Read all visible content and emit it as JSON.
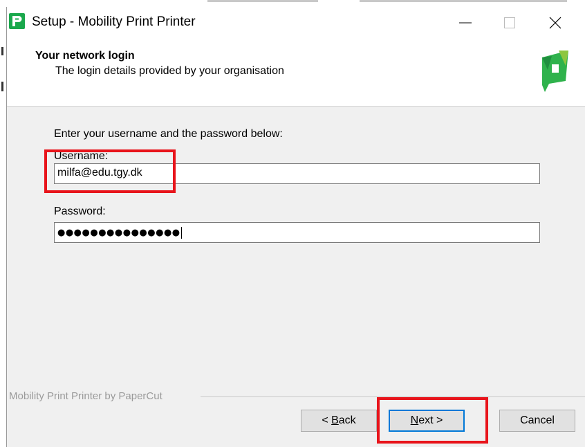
{
  "window": {
    "title": "Setup - Mobility Print Printer",
    "icon": "papercut-app-icon",
    "controls": [
      "minimize-icon",
      "maximize-icon",
      "close-icon"
    ]
  },
  "header": {
    "title": "Your network login",
    "subtitle": "The login details provided by your organisation"
  },
  "form": {
    "instruction": "Enter your username and the password below:",
    "username_label": "Username:",
    "username_value": "milfa@edu.tgy.dk",
    "password_label": "Password:",
    "password_value": "●●●●●●●●●●●●●●●"
  },
  "footer": {
    "brand": "Mobility Print Printer by PaperCut",
    "back_prefix": "< ",
    "back_key": "B",
    "back_rest": "ack",
    "next_key": "N",
    "next_rest": "ext >",
    "cancel": "Cancel"
  },
  "colors": {
    "highlight": "#e8141b",
    "brand_green": "#1aa84c",
    "default_button_border": "#0078d7"
  }
}
